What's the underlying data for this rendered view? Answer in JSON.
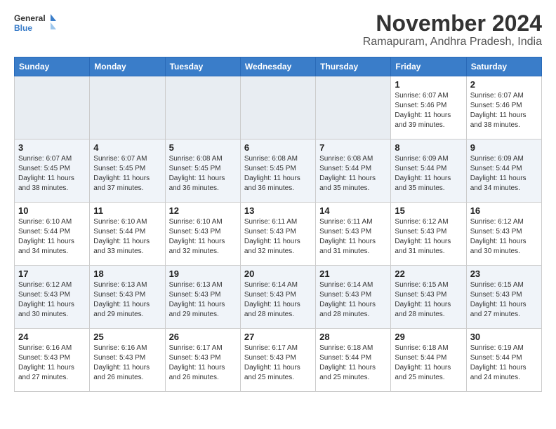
{
  "header": {
    "logo_line1": "General",
    "logo_line2": "Blue",
    "month": "November 2024",
    "location": "Ramapuram, Andhra Pradesh, India"
  },
  "weekdays": [
    "Sunday",
    "Monday",
    "Tuesday",
    "Wednesday",
    "Thursday",
    "Friday",
    "Saturday"
  ],
  "weeks": [
    [
      {
        "day": "",
        "info": ""
      },
      {
        "day": "",
        "info": ""
      },
      {
        "day": "",
        "info": ""
      },
      {
        "day": "",
        "info": ""
      },
      {
        "day": "",
        "info": ""
      },
      {
        "day": "1",
        "info": "Sunrise: 6:07 AM\nSunset: 5:46 PM\nDaylight: 11 hours and 39 minutes."
      },
      {
        "day": "2",
        "info": "Sunrise: 6:07 AM\nSunset: 5:46 PM\nDaylight: 11 hours and 38 minutes."
      }
    ],
    [
      {
        "day": "3",
        "info": "Sunrise: 6:07 AM\nSunset: 5:45 PM\nDaylight: 11 hours and 38 minutes."
      },
      {
        "day": "4",
        "info": "Sunrise: 6:07 AM\nSunset: 5:45 PM\nDaylight: 11 hours and 37 minutes."
      },
      {
        "day": "5",
        "info": "Sunrise: 6:08 AM\nSunset: 5:45 PM\nDaylight: 11 hours and 36 minutes."
      },
      {
        "day": "6",
        "info": "Sunrise: 6:08 AM\nSunset: 5:45 PM\nDaylight: 11 hours and 36 minutes."
      },
      {
        "day": "7",
        "info": "Sunrise: 6:08 AM\nSunset: 5:44 PM\nDaylight: 11 hours and 35 minutes."
      },
      {
        "day": "8",
        "info": "Sunrise: 6:09 AM\nSunset: 5:44 PM\nDaylight: 11 hours and 35 minutes."
      },
      {
        "day": "9",
        "info": "Sunrise: 6:09 AM\nSunset: 5:44 PM\nDaylight: 11 hours and 34 minutes."
      }
    ],
    [
      {
        "day": "10",
        "info": "Sunrise: 6:10 AM\nSunset: 5:44 PM\nDaylight: 11 hours and 34 minutes."
      },
      {
        "day": "11",
        "info": "Sunrise: 6:10 AM\nSunset: 5:44 PM\nDaylight: 11 hours and 33 minutes."
      },
      {
        "day": "12",
        "info": "Sunrise: 6:10 AM\nSunset: 5:43 PM\nDaylight: 11 hours and 32 minutes."
      },
      {
        "day": "13",
        "info": "Sunrise: 6:11 AM\nSunset: 5:43 PM\nDaylight: 11 hours and 32 minutes."
      },
      {
        "day": "14",
        "info": "Sunrise: 6:11 AM\nSunset: 5:43 PM\nDaylight: 11 hours and 31 minutes."
      },
      {
        "day": "15",
        "info": "Sunrise: 6:12 AM\nSunset: 5:43 PM\nDaylight: 11 hours and 31 minutes."
      },
      {
        "day": "16",
        "info": "Sunrise: 6:12 AM\nSunset: 5:43 PM\nDaylight: 11 hours and 30 minutes."
      }
    ],
    [
      {
        "day": "17",
        "info": "Sunrise: 6:12 AM\nSunset: 5:43 PM\nDaylight: 11 hours and 30 minutes."
      },
      {
        "day": "18",
        "info": "Sunrise: 6:13 AM\nSunset: 5:43 PM\nDaylight: 11 hours and 29 minutes."
      },
      {
        "day": "19",
        "info": "Sunrise: 6:13 AM\nSunset: 5:43 PM\nDaylight: 11 hours and 29 minutes."
      },
      {
        "day": "20",
        "info": "Sunrise: 6:14 AM\nSunset: 5:43 PM\nDaylight: 11 hours and 28 minutes."
      },
      {
        "day": "21",
        "info": "Sunrise: 6:14 AM\nSunset: 5:43 PM\nDaylight: 11 hours and 28 minutes."
      },
      {
        "day": "22",
        "info": "Sunrise: 6:15 AM\nSunset: 5:43 PM\nDaylight: 11 hours and 28 minutes."
      },
      {
        "day": "23",
        "info": "Sunrise: 6:15 AM\nSunset: 5:43 PM\nDaylight: 11 hours and 27 minutes."
      }
    ],
    [
      {
        "day": "24",
        "info": "Sunrise: 6:16 AM\nSunset: 5:43 PM\nDaylight: 11 hours and 27 minutes."
      },
      {
        "day": "25",
        "info": "Sunrise: 6:16 AM\nSunset: 5:43 PM\nDaylight: 11 hours and 26 minutes."
      },
      {
        "day": "26",
        "info": "Sunrise: 6:17 AM\nSunset: 5:43 PM\nDaylight: 11 hours and 26 minutes."
      },
      {
        "day": "27",
        "info": "Sunrise: 6:17 AM\nSunset: 5:43 PM\nDaylight: 11 hours and 25 minutes."
      },
      {
        "day": "28",
        "info": "Sunrise: 6:18 AM\nSunset: 5:44 PM\nDaylight: 11 hours and 25 minutes."
      },
      {
        "day": "29",
        "info": "Sunrise: 6:18 AM\nSunset: 5:44 PM\nDaylight: 11 hours and 25 minutes."
      },
      {
        "day": "30",
        "info": "Sunrise: 6:19 AM\nSunset: 5:44 PM\nDaylight: 11 hours and 24 minutes."
      }
    ]
  ]
}
